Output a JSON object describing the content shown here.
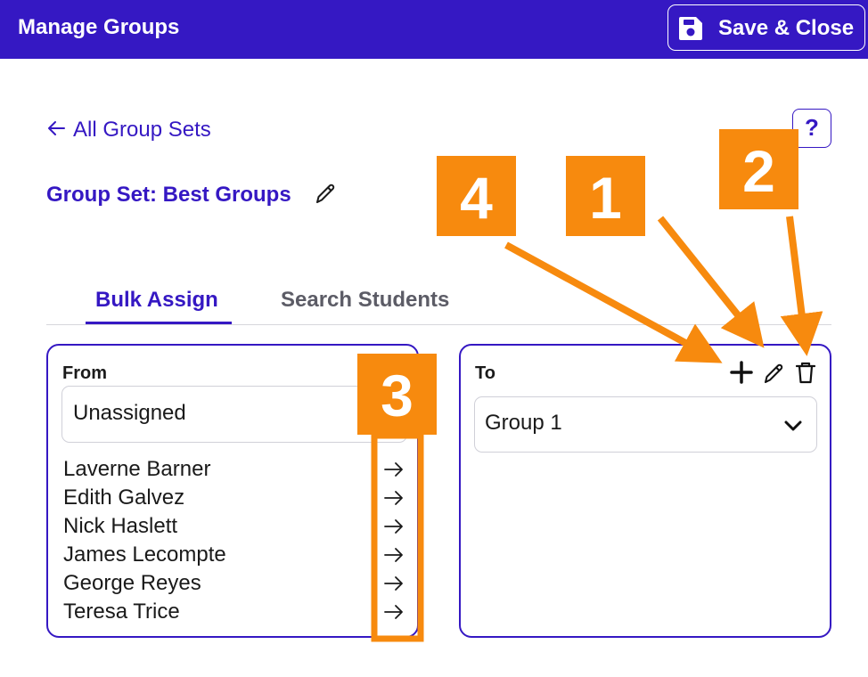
{
  "header": {
    "title": "Manage Groups",
    "save_label": "Save & Close"
  },
  "nav": {
    "back_label": "All Group Sets",
    "help_label": "?"
  },
  "group_set": {
    "title": "Group Set: Best Groups"
  },
  "tabs": [
    {
      "label": "Bulk Assign",
      "active": true
    },
    {
      "label": "Search Students",
      "active": false
    }
  ],
  "from_panel": {
    "label": "From",
    "selected": "Unassigned",
    "students": [
      "Laverne Barner",
      "Edith Galvez",
      "Nick Haslett",
      "James Lecompte",
      "George Reyes",
      "Teresa Trice"
    ]
  },
  "to_panel": {
    "label": "To",
    "selected": "Group 1",
    "actions": [
      "add-icon",
      "edit-icon",
      "delete-icon"
    ]
  },
  "annotations": {
    "callouts": [
      "1",
      "2",
      "3",
      "4"
    ],
    "color": "#f78a0e"
  },
  "colors": {
    "brand": "#3518c3",
    "annotation": "#f78a0e"
  }
}
